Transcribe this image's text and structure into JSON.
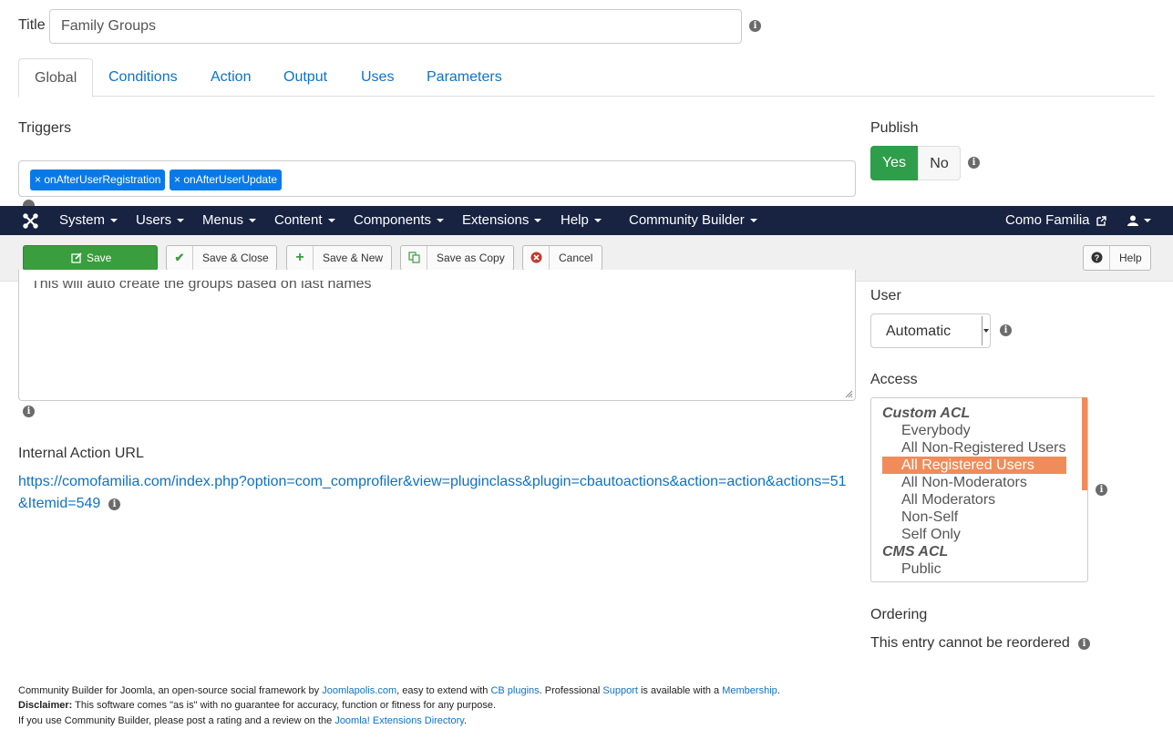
{
  "title": {
    "label": "Title",
    "value": "Family Groups"
  },
  "tabs": [
    {
      "label": "Global"
    },
    {
      "label": "Conditions"
    },
    {
      "label": "Action"
    },
    {
      "label": "Output"
    },
    {
      "label": "Uses"
    },
    {
      "label": "Parameters"
    }
  ],
  "triggers": {
    "label": "Triggers",
    "tags": [
      "onAfterUserRegistration",
      "onAfterUserUpdate"
    ],
    "remove_glyph": "×"
  },
  "publish": {
    "label": "Publish",
    "yes": "Yes",
    "no": "No",
    "selected": "Yes"
  },
  "navbar": {
    "items": [
      "System",
      "Users",
      "Menus",
      "Content",
      "Components",
      "Extensions",
      "Help",
      "Community Builder"
    ],
    "site_link": "Como Familia",
    "bg_color": "#172340"
  },
  "toolbar": {
    "save": "Save",
    "save_close": "Save & Close",
    "save_new": "Save & New",
    "save_copy": "Save as Copy",
    "cancel": "Cancel",
    "help": "Help",
    "save_color": "#3a9d3e"
  },
  "description": {
    "text": "This will auto create the  groups based on last names"
  },
  "user": {
    "label": "User",
    "value": "Automatic"
  },
  "access": {
    "label": "Access",
    "items": [
      {
        "text": "Custom ACL",
        "kind": "group"
      },
      {
        "text": "Everybody",
        "kind": "option"
      },
      {
        "text": "All Non-Registered Users",
        "kind": "option"
      },
      {
        "text": "All Registered Users",
        "kind": "option",
        "selected": true
      },
      {
        "text": "All Non-Moderators",
        "kind": "option"
      },
      {
        "text": "All Moderators",
        "kind": "option"
      },
      {
        "text": "Non-Self",
        "kind": "option"
      },
      {
        "text": "Self Only",
        "kind": "option"
      },
      {
        "text": "CMS ACL",
        "kind": "group"
      },
      {
        "text": "Public",
        "kind": "option"
      }
    ],
    "selected_color": "#f08c5a"
  },
  "internal_url": {
    "label": "Internal Action URL",
    "line1": "https://comofamilia.com/index.php?option=com_comprofiler&view=pluginclass&plugin=cbautoactions&action=action&actions=51",
    "line2": "&Itemid=549"
  },
  "ordering": {
    "label": "Ordering",
    "text": "This entry cannot be reordered"
  },
  "footer": {
    "line1_a": "Community Builder for Joomla, an open-source social framework by ",
    "line1_link1": "Joomlapolis.com",
    "line1_b": ", easy to extend with ",
    "line1_link2": "CB plugins",
    "line1_c": ". Professional ",
    "line1_link3": "Support",
    "line1_d": " is available with a ",
    "line1_link4": "Membership",
    "line1_e": ".",
    "line2_bold": "Disclaimer:",
    "line2_text": " This software comes \"as is\" with no guarantee for accuracy, function or fitness for any purpose.",
    "line3_text": "If you use Community Builder, please post a rating and a review on the ",
    "line3_link": "Joomla! Extensions Directory",
    "line3_end": "."
  },
  "icons": {
    "info": "info-icon",
    "user": "user-icon",
    "external": "external-link-icon",
    "joomla": "joomla-logo"
  }
}
